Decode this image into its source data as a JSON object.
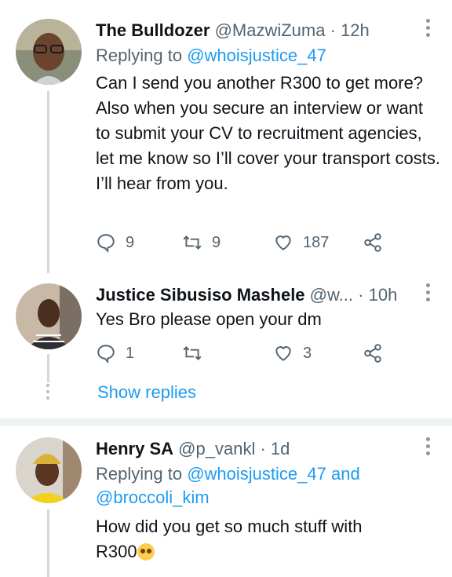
{
  "tweets": [
    {
      "name": "The Bulldozer",
      "handle": "@MazwiZuma",
      "time": "12h",
      "replying_label": "Replying to",
      "replying_to": "@whoisjustice_47",
      "text": "Can I send you another R300 to get more? Also when you secure an interview or want to submit your CV to recruitment agencies, let me know so I’ll cover your transport costs. I’ll hear from you.",
      "replies": "9",
      "retweets": "9",
      "likes": "187"
    },
    {
      "name": "Justice Sibusiso Mashele",
      "handle": "@w...",
      "time": "10h",
      "text": "Yes Bro please open your dm",
      "replies": "1",
      "retweets": "",
      "likes": "3",
      "show_replies": "Show replies"
    },
    {
      "name": "Henry SA",
      "handle": "@p_vankl",
      "time": "1d",
      "replying_label": "Replying to",
      "replying_to": "@whoisjustice_47",
      "replying_and": "and",
      "replying_to_2": "@broccoli_kim",
      "text_line1": "How did you get so much stuff with",
      "text_line2": "R300",
      "emoji": "pleading-face-emoji"
    }
  ],
  "separator": "·",
  "colors": {
    "accent": "#1d9bf0",
    "secondary": "#536471",
    "divider": "#eff3f4"
  },
  "icons": [
    "reply-icon",
    "retweet-icon",
    "like-icon",
    "share-icon",
    "more-options-icon"
  ]
}
